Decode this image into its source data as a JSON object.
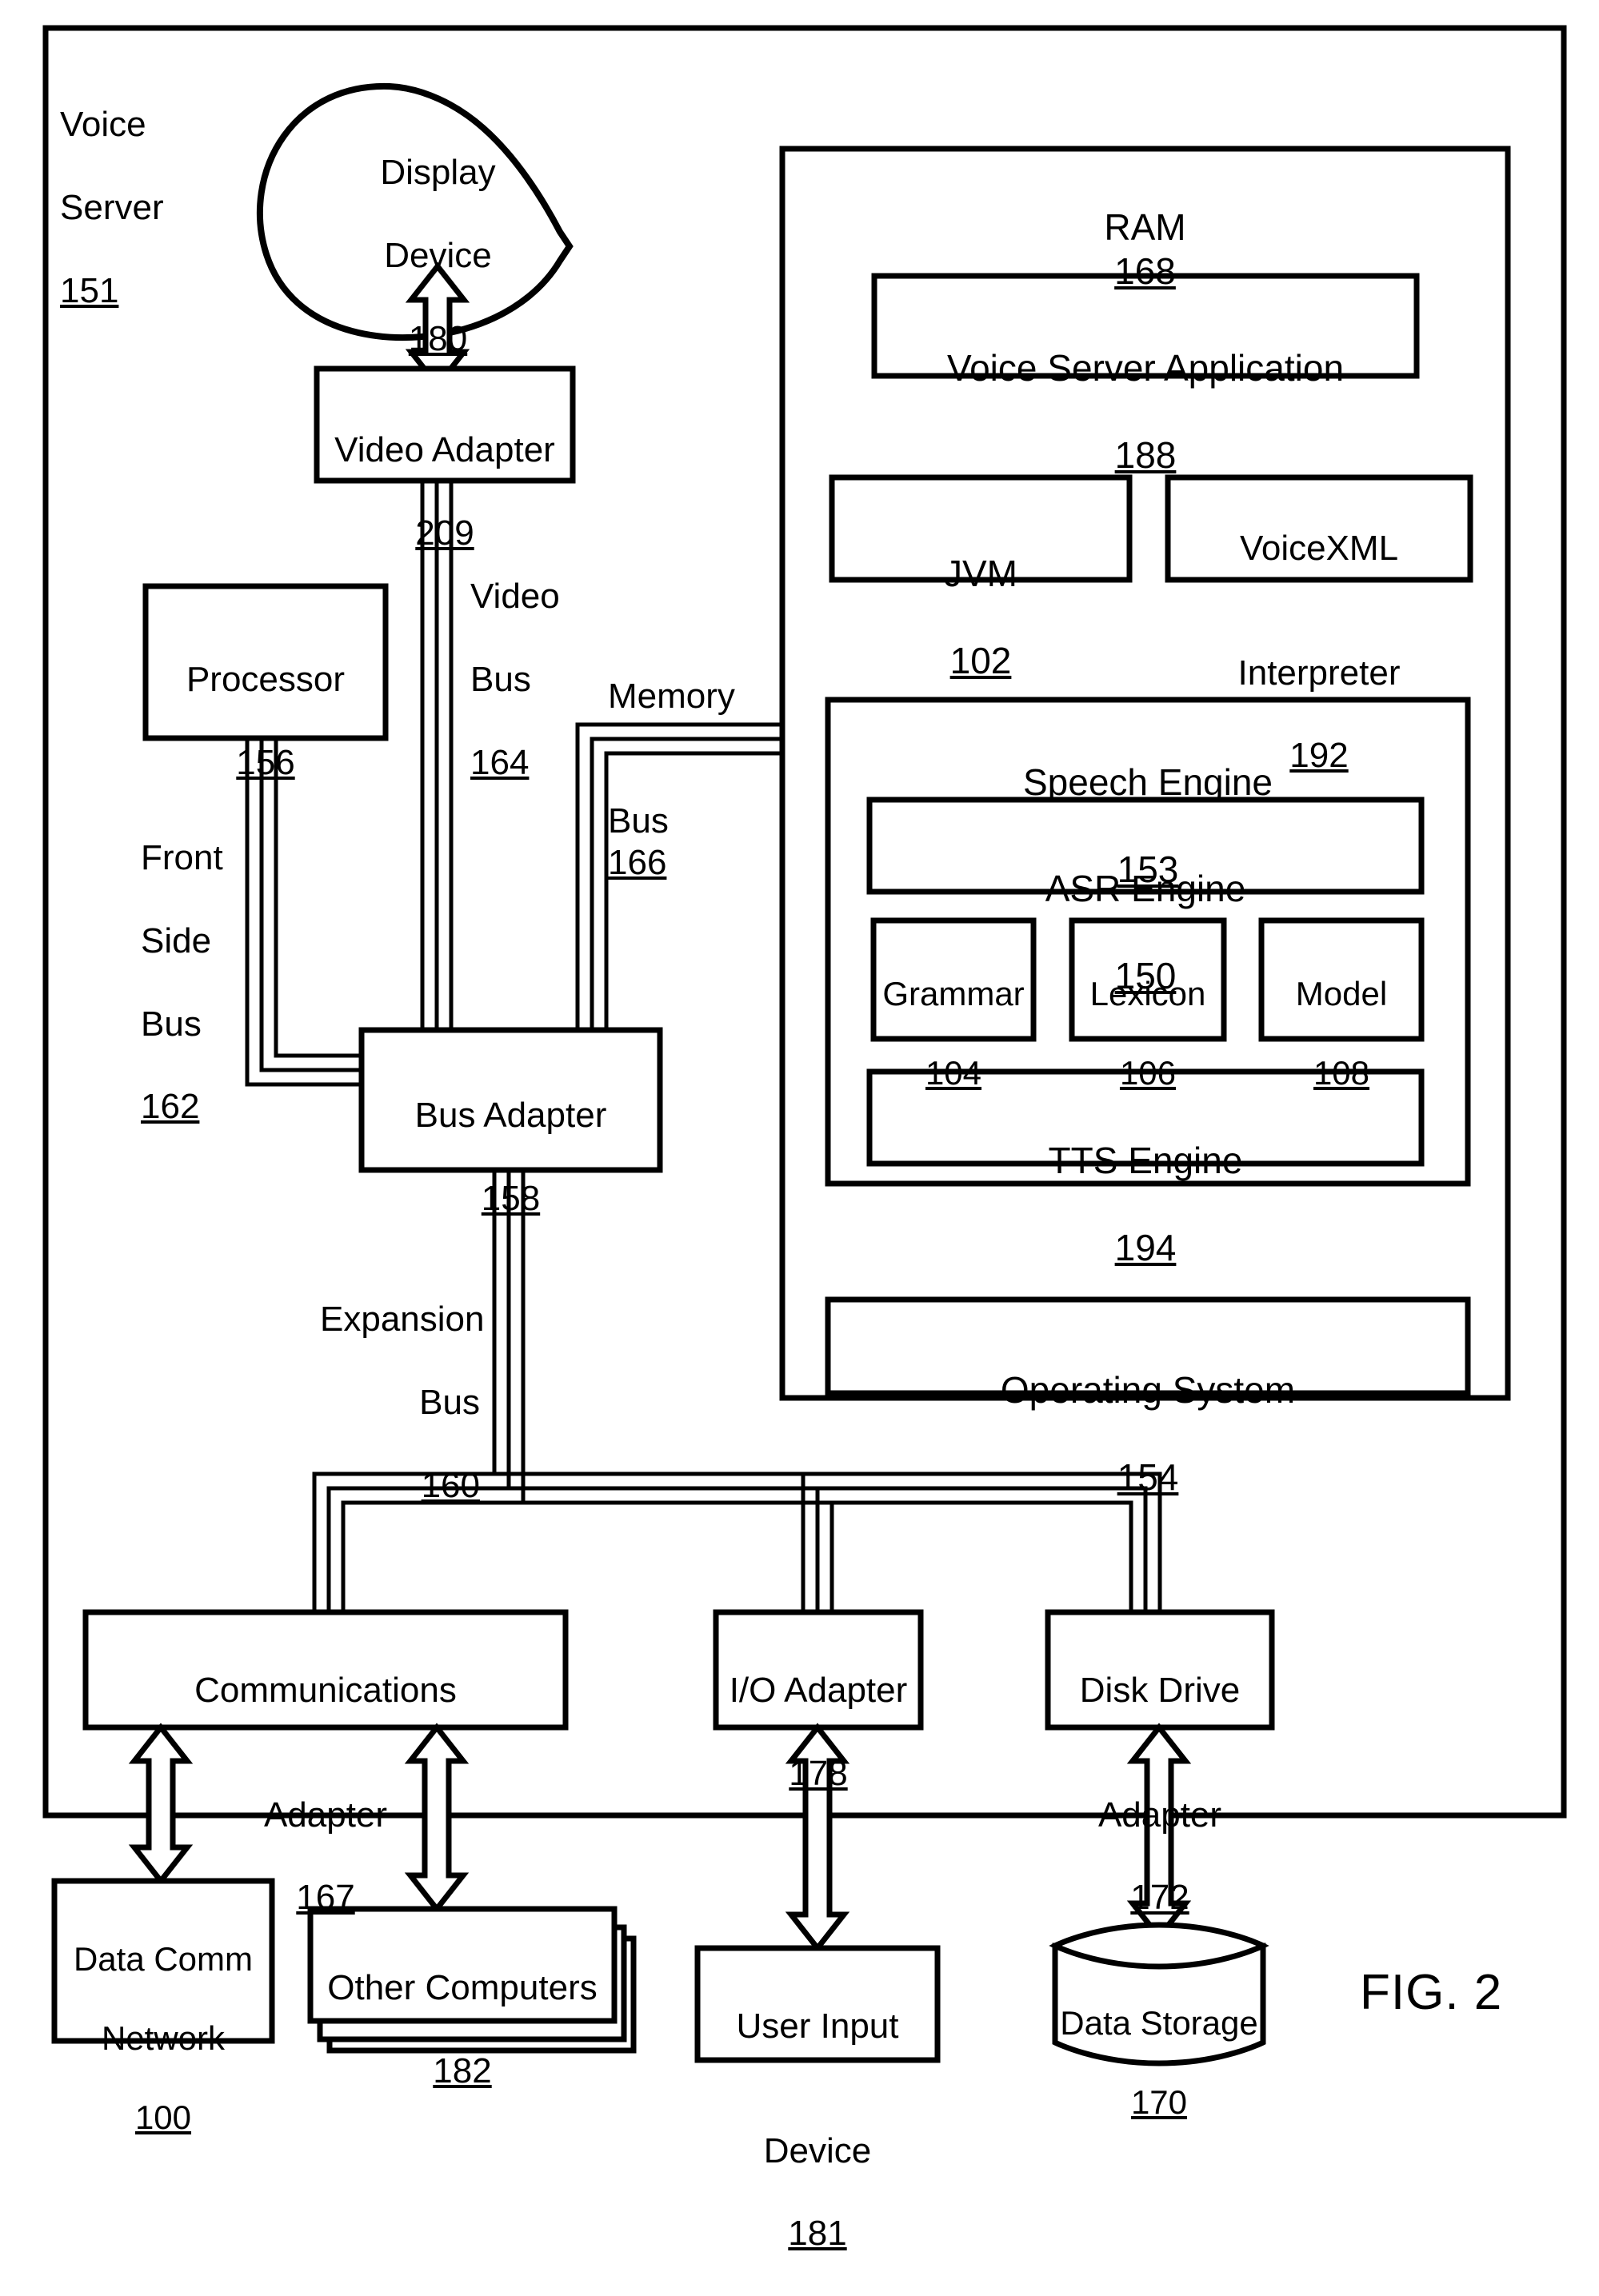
{
  "figure": {
    "caption": "FIG. 2"
  },
  "outer": {
    "title_line1": "Voice",
    "title_line2": "Server",
    "ref": "151"
  },
  "display": {
    "label_line1": "Display",
    "label_line2": "Device",
    "ref": "180"
  },
  "video_adapter": {
    "label": "Video Adapter",
    "ref": "209"
  },
  "processor": {
    "label": "Processor",
    "ref": "156"
  },
  "bus_adapter": {
    "label": "Bus Adapter",
    "ref": "158"
  },
  "buses": {
    "video": {
      "line1": "Video",
      "line2": "Bus",
      "ref": "164"
    },
    "memory": {
      "line1": "Memory",
      "line2": "Bus",
      "ref": "166"
    },
    "front_side": {
      "line1": "Front",
      "line2": "Side",
      "line3": "Bus",
      "ref": "162"
    },
    "expansion": {
      "line1": "Expansion",
      "line2": "Bus",
      "ref": "160"
    }
  },
  "ram": {
    "title": "RAM",
    "ref": "168",
    "voice_server_application": {
      "label": "Voice Server Application",
      "ref": "188"
    },
    "jvm": {
      "label": "JVM",
      "ref": "102"
    },
    "voicexml_interpreter": {
      "line1": "VoiceXML",
      "line2": "Interpreter",
      "ref": "192"
    },
    "speech_engine": {
      "title": "Speech Engine",
      "ref": "153",
      "asr_engine": {
        "label": "ASR Engine",
        "ref": "150"
      },
      "grammar": {
        "label": "Grammar",
        "ref": "104"
      },
      "lexicon": {
        "label": "Lexicon",
        "ref": "106"
      },
      "model": {
        "label": "Model",
        "ref": "108"
      },
      "tts_engine": {
        "label": "TTS Engine",
        "ref": "194"
      }
    },
    "operating_system": {
      "label": "Operating System",
      "ref": "154"
    }
  },
  "adapters": {
    "communications": {
      "line1": "Communications",
      "line2": "Adapter",
      "ref": "167"
    },
    "io": {
      "line1": "I/O Adapter",
      "ref": "178"
    },
    "disk_drive": {
      "line1": "Disk Drive",
      "line2": "Adapter",
      "ref": "172"
    }
  },
  "peripherals": {
    "data_comm_network": {
      "line1": "Data Comm",
      "line2": "Network",
      "ref": "100"
    },
    "other_computers": {
      "label": "Other Computers",
      "ref": "182"
    },
    "user_input_device": {
      "line1": "User Input",
      "line2": "Device",
      "ref": "181"
    },
    "data_storage": {
      "label": "Data Storage",
      "ref": "170"
    }
  },
  "colors": {
    "ink": "#000000",
    "paper": "#ffffff"
  }
}
